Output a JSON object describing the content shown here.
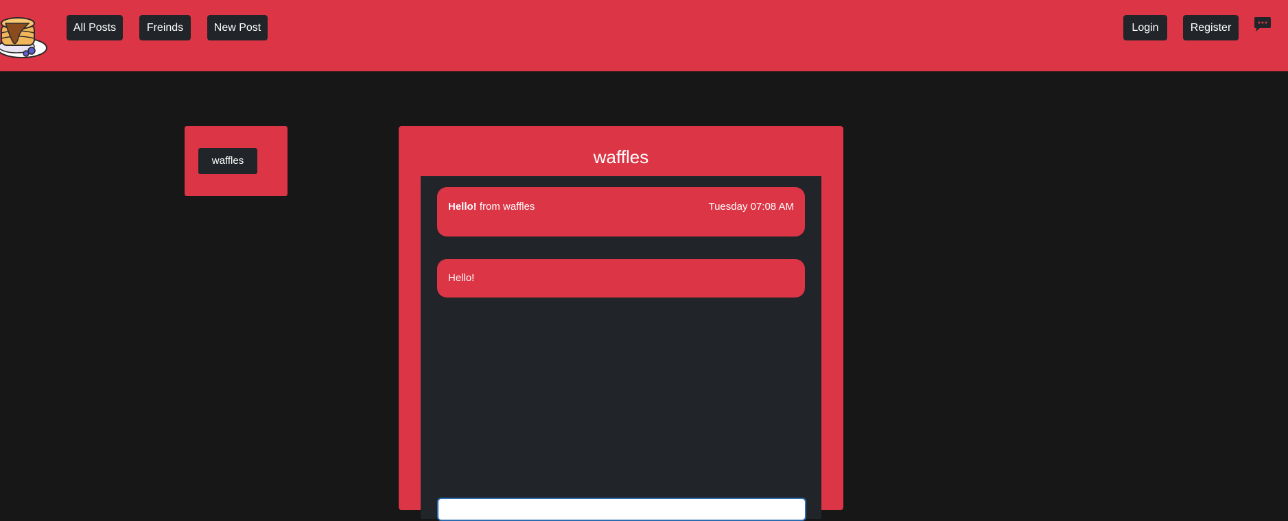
{
  "navbar": {
    "logo_icon": "pancake-stack-logo-icon",
    "links": [
      {
        "label": "All Posts"
      },
      {
        "label": "Freinds"
      },
      {
        "label": "New Post"
      }
    ],
    "auth": [
      {
        "label": "Login"
      },
      {
        "label": "Register"
      }
    ],
    "chat_icon": "chat-bubble-icon"
  },
  "friends": {
    "items": [
      {
        "label": "waffles"
      }
    ]
  },
  "chat": {
    "title": "waffles",
    "messages": [
      {
        "greeting": "Hello!",
        "from": "from waffles",
        "time": "Tuesday 07:08 AM"
      },
      {
        "text": "Hello!"
      }
    ],
    "input_value": ""
  },
  "colors": {
    "primary": "#dc3545",
    "dark": "#212529",
    "background": "#171717"
  }
}
